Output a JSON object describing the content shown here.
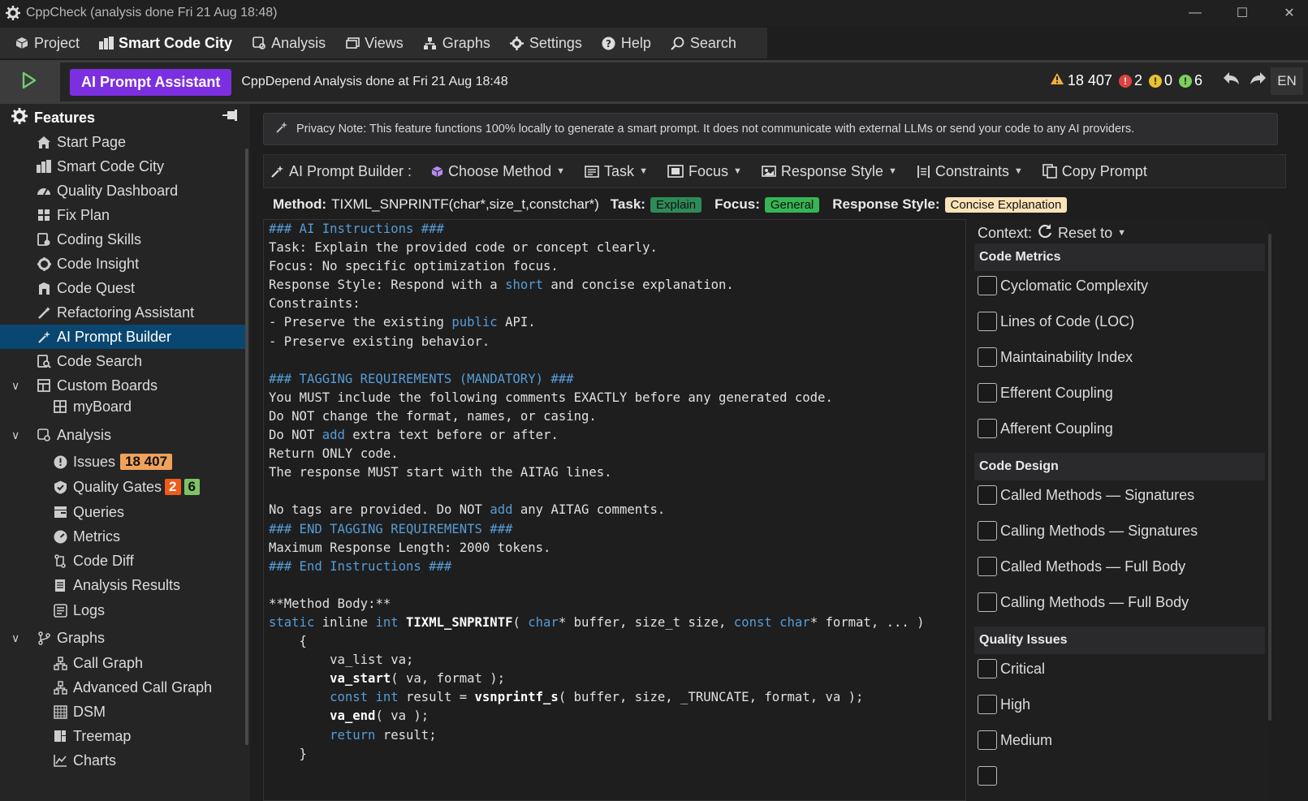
{
  "window": {
    "title": "CppCheck (analysis done Fri 21 Aug  18:48)"
  },
  "menu": [
    {
      "label": "Project",
      "icon": "cube-icon"
    },
    {
      "label": "Smart Code City",
      "icon": "city-icon",
      "bold": true
    },
    {
      "label": "Analysis",
      "icon": "analysis-icon"
    },
    {
      "label": "Views",
      "icon": "views-icon"
    },
    {
      "label": "Graphs",
      "icon": "graph-icon"
    },
    {
      "label": "Settings",
      "icon": "gear-icon"
    },
    {
      "label": "Help",
      "icon": "help-icon"
    },
    {
      "label": "Search",
      "icon": "search-icon"
    }
  ],
  "toolbar": {
    "ai_button": "AI Prompt Assistant",
    "status_message": "CppDepend Analysis done at Fri 21 Aug  18:48",
    "counts": {
      "warnings": "18 407",
      "red": "2",
      "yellow": "0",
      "green": "6"
    },
    "language": "EN"
  },
  "sidebar": {
    "header": "Features",
    "items": [
      {
        "label": "Start Page",
        "icon": "home-icon"
      },
      {
        "label": "Smart Code City",
        "icon": "city-icon"
      },
      {
        "label": "Quality Dashboard",
        "icon": "dashboard-icon"
      },
      {
        "label": "Fix Plan",
        "icon": "plan-icon"
      },
      {
        "label": "Coding Skills",
        "icon": "skills-icon"
      },
      {
        "label": "Code Insight",
        "icon": "insight-icon"
      },
      {
        "label": "Code Quest",
        "icon": "quest-icon"
      },
      {
        "label": "Refactoring Assistant",
        "icon": "wand-icon"
      },
      {
        "label": "AI Prompt Builder",
        "icon": "sparkle-icon"
      },
      {
        "label": "Code Search",
        "icon": "code-search-icon"
      },
      {
        "label": "Custom Boards",
        "icon": "boards-icon"
      },
      {
        "label": "myBoard",
        "icon": "board-icon"
      },
      {
        "label": "Analysis",
        "icon": "analysis-icon"
      },
      {
        "label": "Issues",
        "icon": "issue-icon",
        "badge": "18 407"
      },
      {
        "label": "Quality Gates",
        "icon": "gate-icon",
        "badge_red": "2",
        "badge_green": "6"
      },
      {
        "label": "Queries",
        "icon": "queries-icon"
      },
      {
        "label": "Metrics",
        "icon": "metrics-icon"
      },
      {
        "label": "Code Diff",
        "icon": "diff-icon"
      },
      {
        "label": "Analysis Results",
        "icon": "results-icon"
      },
      {
        "label": "Logs",
        "icon": "logs-icon"
      },
      {
        "label": "Graphs",
        "icon": "graph-branch-icon"
      },
      {
        "label": "Call Graph",
        "icon": "call-graph-icon"
      },
      {
        "label": "Advanced Call Graph",
        "icon": "adv-call-graph-icon"
      },
      {
        "label": "DSM",
        "icon": "dsm-icon"
      },
      {
        "label": "Treemap",
        "icon": "treemap-icon"
      },
      {
        "label": "Charts",
        "icon": "chart-icon"
      }
    ]
  },
  "privacy_note": "Privacy Note: This feature functions 100% locally to generate a smart prompt. It does not communicate with external LLMs or send your code to any AI providers.",
  "prompt_toolbar": {
    "title": "AI Prompt Builder :",
    "choose_method": "Choose Method",
    "task": "Task",
    "focus": "Focus",
    "response_style": "Response Style",
    "constraints": "Constraints",
    "copy_prompt": "Copy Prompt"
  },
  "info": {
    "method_label": "Method:",
    "method_value": "TIXML_SNPRINTF(char*,size_t,constchar*)",
    "task_label": "Task:",
    "task_value": "Explain",
    "focus_label": "Focus:",
    "focus_value": "General",
    "style_label": "Response Style:",
    "style_value": "Concise Explanation"
  },
  "code_lines": [
    "### AI Instructions ###",
    "Task: Explain the provided code or concept clearly.",
    "Focus: No specific optimization focus.",
    "Response Style: Respond with a short and concise explanation.",
    "Constraints:",
    "- Preserve the existing public API.",
    "- Preserve existing behavior.",
    "",
    "### TAGGING REQUIREMENTS (MANDATORY) ###",
    "You MUST include the following comments EXACTLY before any generated code.",
    "Do NOT change the format, names, or casing.",
    "Do NOT add extra text before or after.",
    "Return ONLY code.",
    "The response MUST start with the AITAG lines.",
    "",
    "No tags are provided. Do NOT add any AITAG comments.",
    "### END TAGGING REQUIREMENTS ###",
    "Maximum Response Length: 2000 tokens.",
    "### End Instructions ###",
    "",
    "**Method Body:**",
    "static inline int TIXML_SNPRINTF( char* buffer, size_t size, const char* format, ... )",
    "    {",
    "        va_list va;",
    "        va_start( va, format );",
    "        const int result = vsnprintf_s( buffer, size, _TRUNCATE, format, va );",
    "        va_end( va );",
    "        return result;",
    "    }"
  ],
  "context": {
    "label": "Context:",
    "reset": "Reset to",
    "sections": [
      {
        "title": "Code Metrics",
        "items": [
          "Cyclomatic Complexity",
          "Lines of Code (LOC)",
          "Maintainability Index",
          "Efferent Coupling",
          "Afferent Coupling"
        ]
      },
      {
        "title": "Code Design",
        "items": [
          "Called Methods — Signatures",
          "Calling Methods — Signatures",
          "Called Methods — Full Body",
          "Calling Methods — Full Body"
        ]
      },
      {
        "title": "Quality Issues",
        "items": [
          "Critical",
          "High",
          "Medium"
        ]
      }
    ]
  },
  "colors": {
    "accent": "#7c2fe0",
    "selection": "#094771",
    "keyword": "#569cd6"
  }
}
